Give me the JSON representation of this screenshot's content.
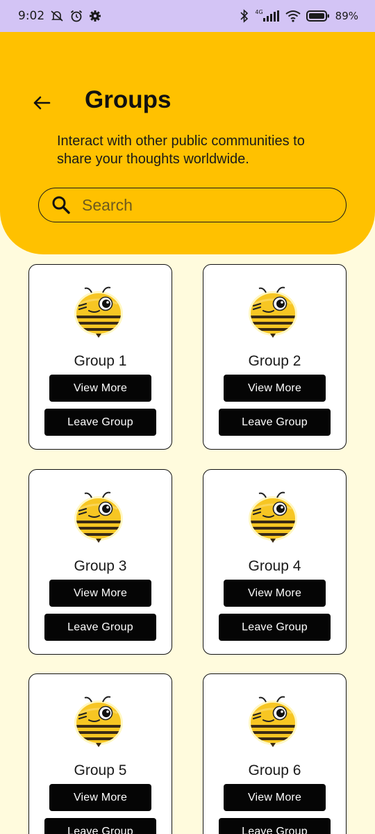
{
  "status_bar": {
    "time": "9:02",
    "network_label": "4G",
    "battery": "89%"
  },
  "header": {
    "title": "Groups",
    "subtitle": "Interact with other public communities to share your thoughts worldwide.",
    "search_placeholder": "Search"
  },
  "groups": [
    {
      "name": "Group 1",
      "view_label": "View More",
      "leave_label": "Leave Group"
    },
    {
      "name": "Group 2",
      "view_label": "View More",
      "leave_label": "Leave Group"
    },
    {
      "name": "Group 3",
      "view_label": "View More",
      "leave_label": "Leave Group"
    },
    {
      "name": "Group 4",
      "view_label": "View More",
      "leave_label": "Leave Group"
    },
    {
      "name": "Group 5",
      "view_label": "View More",
      "leave_label": "Leave Group"
    },
    {
      "name": "Group 6",
      "view_label": "View More",
      "leave_label": "Leave Group"
    }
  ],
  "icons": {
    "back": "arrow-left-icon",
    "search": "search-icon",
    "group_avatar": "bee-mascot-icon"
  },
  "colors": {
    "status_bar": "#d3c4f5",
    "header": "#ffc100",
    "background": "#fffbdd",
    "button": "#050505"
  }
}
